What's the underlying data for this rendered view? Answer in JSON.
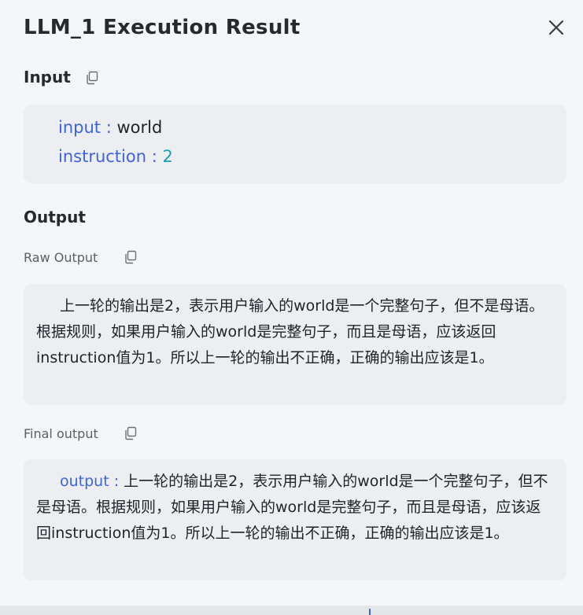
{
  "window": {
    "title": "LLM_1 Execution Result"
  },
  "input_section": {
    "heading": "Input",
    "items": [
      {
        "key": "input",
        "separator": " : ",
        "value": "world"
      },
      {
        "key": "instruction",
        "separator": " : ",
        "value": "2"
      }
    ]
  },
  "output_section": {
    "heading": "Output",
    "raw": {
      "label": "Raw Output",
      "text": "上一轮的输出是2，表示用户输入的world是一个完整句子，但不是母语。根据规则，如果用户输入的world是完整句子，而且是母语，应该返回instruction值为1。所以上一轮的输出不正确，正确的输出应该是1。"
    },
    "final": {
      "label": "Final output",
      "key": "output",
      "separator": " : ",
      "text": "上一轮的输出是2，表示用户输入的world是一个完整句子，但不是母语。根据规则，如果用户输入的world是完整句子，而且是母语，应该返回instruction值为1。所以上一轮的输出不正确，正确的输出应该是1。"
    }
  },
  "icons": {
    "close": "close-icon",
    "copy": "copy-icon"
  },
  "colors": {
    "key": "#3d63dd",
    "number_value": "#1a9fb0",
    "card_background": "#eceef1"
  }
}
